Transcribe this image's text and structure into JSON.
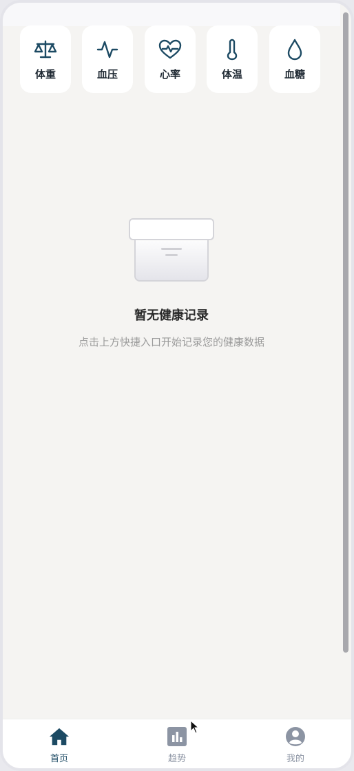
{
  "quick_entries": [
    {
      "label": "体重",
      "icon": "scale-icon"
    },
    {
      "label": "血压",
      "icon": "pulse-line-icon"
    },
    {
      "label": "心率",
      "icon": "heart-rate-icon"
    },
    {
      "label": "体温",
      "icon": "thermometer-icon"
    },
    {
      "label": "血糖",
      "icon": "drop-icon"
    }
  ],
  "empty_state": {
    "icon": "empty-box-icon",
    "title": "暂无健康记录",
    "subtitle": "点击上方快捷入口开始记录您的健康数据"
  },
  "tabbar": {
    "tabs": [
      {
        "label": "首页",
        "icon": "home-icon",
        "active": true
      },
      {
        "label": "趋势",
        "icon": "chart-icon",
        "active": false
      },
      {
        "label": "我的",
        "icon": "user-icon",
        "active": false
      }
    ]
  },
  "colors": {
    "accent": "#1c4a63",
    "inactive": "#8c94a3",
    "background": "#f5f4f2"
  }
}
